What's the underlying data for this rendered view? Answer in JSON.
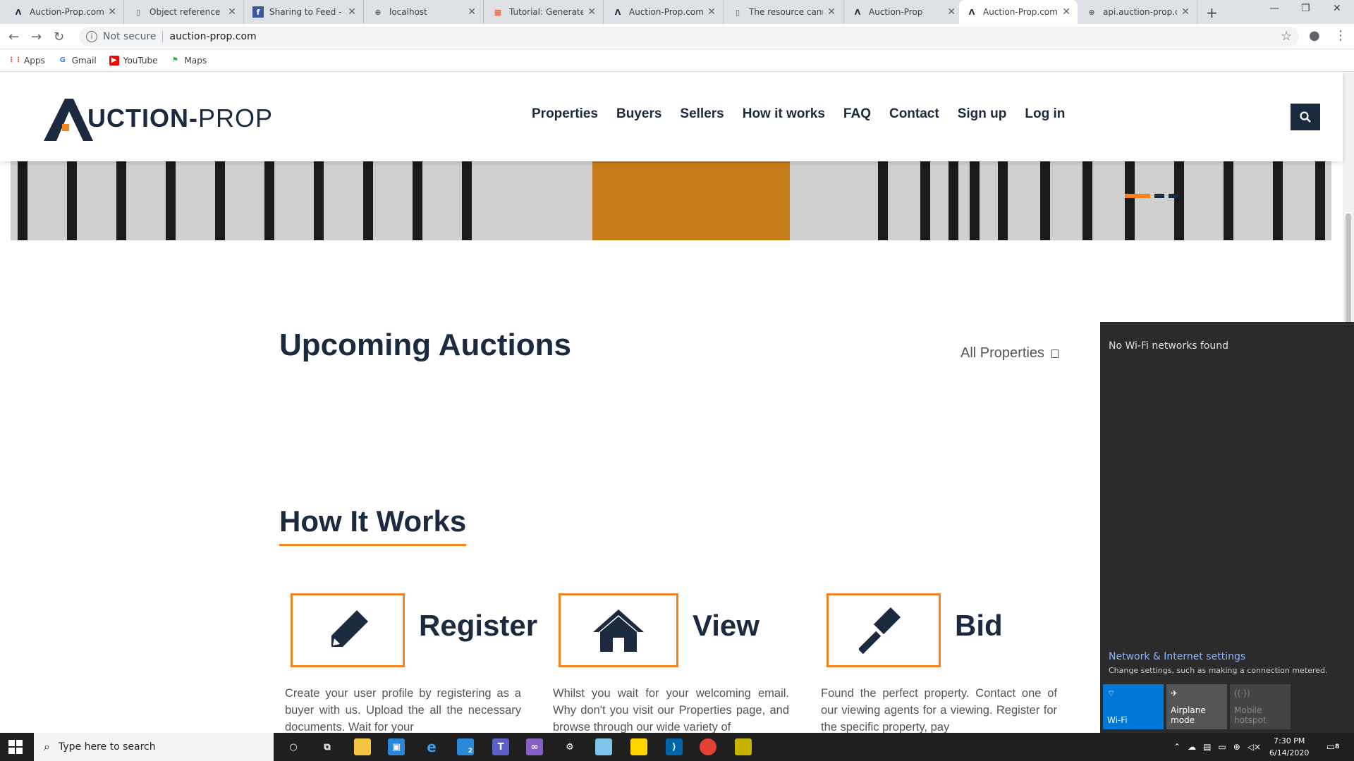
{
  "browser": {
    "tabs": [
      {
        "title": "Auction-Prop.com",
        "icon": "auction-prop-favicon"
      },
      {
        "title": "Object reference no",
        "icon": "doc-favicon"
      },
      {
        "title": "Sharing to Feed - Ir",
        "icon": "facebook-favicon"
      },
      {
        "title": "localhost",
        "icon": "globe-favicon"
      },
      {
        "title": "Tutorial: Generate v",
        "icon": "microsoft-favicon"
      },
      {
        "title": "Auction-Prop.com",
        "icon": "auction-prop-favicon"
      },
      {
        "title": "The resource canno",
        "icon": "doc-favicon"
      },
      {
        "title": "Auction-Prop",
        "icon": "auction-prop-favicon"
      },
      {
        "title": "Auction-Prop.com",
        "icon": "auction-prop-favicon",
        "active": true
      },
      {
        "title": "api.auction-prop.co",
        "icon": "globe-favicon"
      }
    ],
    "security_label": "Not secure",
    "url": "auction-prop.com",
    "bookmarks": [
      {
        "label": "Apps",
        "icon": "apps-grid-icon"
      },
      {
        "label": "Gmail",
        "icon": "gmail-icon"
      },
      {
        "label": "YouTube",
        "icon": "youtube-icon"
      },
      {
        "label": "Maps",
        "icon": "maps-icon"
      }
    ]
  },
  "site": {
    "logo_main": "UCTION-",
    "logo_sub": "PROP",
    "nav": [
      "Properties",
      "Buyers",
      "Sellers",
      "How it works",
      "FAQ",
      "Contact",
      "Sign up",
      "Log in"
    ],
    "upcoming_title": "Upcoming Auctions",
    "all_properties_link": "All Properties",
    "how_it_works_title": "How It Works",
    "steps": [
      {
        "title": "Register",
        "icon": "pencil-icon",
        "desc": "Create your user profile by registering as a buyer with us. Upload the all the necessary documents. Wait for your"
      },
      {
        "title": "View",
        "icon": "house-icon",
        "desc": "Whilst you wait for your welcoming email. Why don't you visit our Properties page, and browse through our wide variety of"
      },
      {
        "title": "Bid",
        "icon": "gavel-icon",
        "desc": "Found the perfect property. Contact one of our viewing agents for a viewing. Register for the specific property, pay"
      }
    ],
    "accent_color": "#f58220",
    "primary_color": "#1c2a3f"
  },
  "network_flyout": {
    "status": "No Wi-Fi networks found",
    "settings_link": "Network & Internet settings",
    "settings_sub": "Change settings, such as making a connection metered.",
    "quick_actions": [
      {
        "label": "Wi-Fi"
      },
      {
        "label": "Airplane mode"
      },
      {
        "label": "Mobile hotspot"
      }
    ]
  },
  "taskbar": {
    "search_placeholder": "Type here to search",
    "mail_badge": "2",
    "time": "7:30 PM",
    "date": "6/14/2020",
    "notification_count": "8"
  }
}
